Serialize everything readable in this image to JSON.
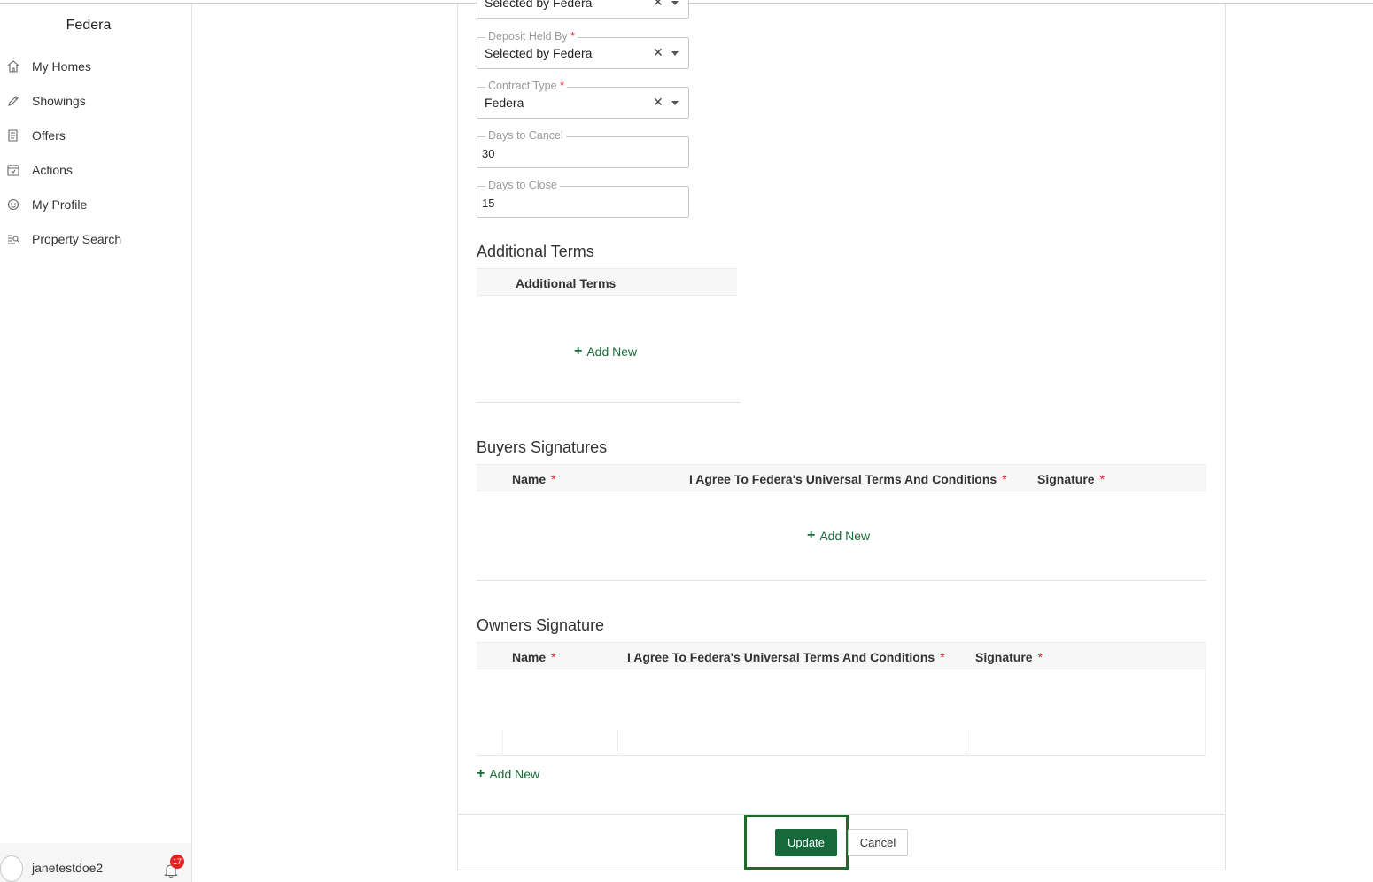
{
  "app": {
    "brand": "Federa"
  },
  "sidebar": {
    "items": [
      {
        "label": "My Homes",
        "icon": "home-icon"
      },
      {
        "label": "Showings",
        "icon": "pen-icon"
      },
      {
        "label": "Offers",
        "icon": "document-icon"
      },
      {
        "label": "Actions",
        "icon": "calendar-icon"
      },
      {
        "label": "My Profile",
        "icon": "profile-icon"
      },
      {
        "label": "Property Search",
        "icon": "search-list-icon"
      }
    ],
    "user": {
      "name": "janetestdoe2",
      "notifications": "17"
    }
  },
  "form": {
    "fields": [
      {
        "label": "",
        "value": "Selected by Federa",
        "required": false
      },
      {
        "label": "Deposit Held By",
        "value": "Selected by Federa",
        "required": true
      },
      {
        "label": "Contract Type",
        "value": "Federa",
        "required": true
      },
      {
        "label": "Days to Cancel",
        "value": "30",
        "required": false
      },
      {
        "label": "Days to Close",
        "value": "15",
        "required": false
      }
    ],
    "clear_glyph": "✕",
    "required_mark": "*"
  },
  "additional_terms": {
    "title": "Additional Terms",
    "column": "Additional Terms",
    "add_label": "Add New"
  },
  "buyers_signatures": {
    "title": "Buyers Signatures",
    "columns": [
      "Name",
      "I Agree To Federa's Universal Terms And Conditions",
      "Signature"
    ],
    "add_label": "Add New"
  },
  "owners_signature": {
    "title": "Owners Signature",
    "columns": [
      "Name",
      "I Agree To Federa's Universal Terms And Conditions",
      "Signature"
    ],
    "add_label": "Add New"
  },
  "actions": {
    "update_label": "Update",
    "cancel_label": "Cancel"
  },
  "colors": {
    "accent": "#15693a",
    "required": "#e02424",
    "highlight_border": "#1e6b2e"
  }
}
